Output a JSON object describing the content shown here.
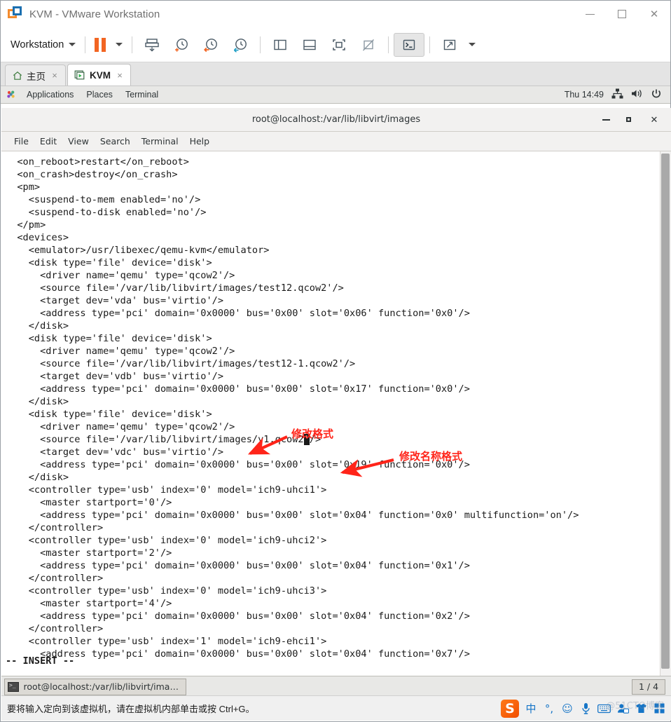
{
  "vmware": {
    "title": "KVM - VMware Workstation",
    "logo_icon": "vmware-logo-icon",
    "window_controls": {
      "minimize": "minimize-icon",
      "maximize": "maximize-icon",
      "close": "close-icon"
    },
    "toolbar": {
      "workstation_label": "Workstation",
      "items": [
        {
          "name": "pause-vm-button",
          "icon": "pause-icon"
        },
        {
          "name": "pause-dropdown-button",
          "icon": "chevron-down-icon"
        },
        {
          "name": "send-ctrl-alt-del-button",
          "icon": "send-key-icon"
        },
        {
          "name": "take-snapshot-button",
          "icon": "snapshot-add-icon"
        },
        {
          "name": "revert-snapshot-button",
          "icon": "snapshot-revert-icon"
        },
        {
          "name": "manage-snapshots-button",
          "icon": "snapshot-manage-icon"
        },
        {
          "name": "show-library-button",
          "icon": "panel-left-icon"
        },
        {
          "name": "show-thumbnail-bar-button",
          "icon": "panel-bottom-icon"
        },
        {
          "name": "show-console-view-button",
          "icon": "console-view-icon"
        },
        {
          "name": "hide-console-view-button",
          "icon": "console-view-off-icon"
        },
        {
          "name": "full-screen-button",
          "icon": "terminal-prompt-icon"
        },
        {
          "name": "unity-mode-button",
          "icon": "expand-arrows-icon"
        },
        {
          "name": "unity-dropdown-button",
          "icon": "chevron-down-icon"
        }
      ]
    },
    "tabs": [
      {
        "name": "tab-home",
        "label": "主页",
        "icon": "home-icon",
        "active": false,
        "close": "×"
      },
      {
        "name": "tab-kvm",
        "label": "KVM",
        "icon": "vm-running-icon",
        "active": true,
        "close": "×"
      }
    ],
    "statusbar": {
      "message": "要将输入定向到该虚拟机，请在虚拟机内部单击或按 Ctrl+G。"
    }
  },
  "guest_panel": {
    "menus": [
      "Applications",
      "Places",
      "Terminal"
    ],
    "clock": "Thu 14:49",
    "tray": [
      {
        "name": "network-icon",
        "glyph": "network"
      },
      {
        "name": "volume-icon",
        "glyph": "volume"
      },
      {
        "name": "power-icon",
        "glyph": "power"
      }
    ]
  },
  "terminal": {
    "title": "root@localhost:/var/lib/libvirt/images",
    "window_controls": {
      "minimize": "minimize-icon",
      "maximize": "maximize-icon",
      "close": "close-icon"
    },
    "menus": [
      "File",
      "Edit",
      "View",
      "Search",
      "Terminal",
      "Help"
    ],
    "mode_line": "-- INSERT --",
    "content_before_cursor": "  <on_reboot>restart</on_reboot>\n  <on_crash>destroy</on_crash>\n  <pm>\n    <suspend-to-mem enabled='no'/>\n    <suspend-to-disk enabled='no'/>\n  </pm>\n  <devices>\n    <emulator>/usr/libexec/qemu-kvm</emulator>\n    <disk type='file' device='disk'>\n      <driver name='qemu' type='qcow2'/>\n      <source file='/var/lib/libvirt/images/test12.qcow2'/>\n      <target dev='vda' bus='virtio'/>\n      <address type='pci' domain='0x0000' bus='0x00' slot='0x06' function='0x0'/>\n    </disk>\n    <disk type='file' device='disk'>\n      <driver name='qemu' type='qcow2'/>\n      <source file='/var/lib/libvirt/images/test12-1.qcow2'/>\n      <target dev='vdb' bus='virtio'/>\n      <address type='pci' domain='0x0000' bus='0x00' slot='0x17' function='0x0'/>\n    </disk>\n    <disk type='file' device='disk'>\n      <driver name='qemu' type='qcow2'/>\n      <source file='/var/lib/libvirt/images/y1.qcow2",
    "cursor_char": "'",
    "content_after_cursor": "/>\n      <target dev='vdc' bus='virtio'/>\n      <address type='pci' domain='0x0000' bus='0x00' slot='0x19' function='0x0'/>\n    </disk>\n    <controller type='usb' index='0' model='ich9-uhci1'>\n      <master startport='0'/>\n      <address type='pci' domain='0x0000' bus='0x00' slot='0x04' function='0x0' multifunction='on'/>\n    </controller>\n    <controller type='usb' index='0' model='ich9-uhci2'>\n      <master startport='2'/>\n      <address type='pci' domain='0x0000' bus='0x00' slot='0x04' function='0x1'/>\n    </controller>\n    <controller type='usb' index='0' model='ich9-uhci3'>\n      <master startport='4'/>\n      <address type='pci' domain='0x0000' bus='0x00' slot='0x04' function='0x2'/>\n    </controller>\n    <controller type='usb' index='1' model='ich9-ehci1'>\n      <address type='pci' domain='0x0000' bus='0x00' slot='0x04' function='0x7'/>",
    "annotations": [
      {
        "name": "annotation-modify-format",
        "text": "修改格式",
        "color": "#ff2419"
      },
      {
        "name": "annotation-modify-name-format",
        "text": "修改名称格式",
        "color": "#ff2419"
      }
    ]
  },
  "guest_taskbar": {
    "task_label": "root@localhost:/var/lib/libvirt/images",
    "task_icon": "terminal-icon",
    "workspace": "1 / 4"
  },
  "ime": {
    "logo": "S",
    "items": [
      {
        "name": "ime-chinese-mode",
        "glyph": "中"
      },
      {
        "name": "ime-punctuation-mode",
        "glyph": "°,"
      },
      {
        "name": "ime-emoji-button",
        "glyph": "☺"
      },
      {
        "name": "ime-voice-input-button",
        "glyph": "🎤"
      },
      {
        "name": "ime-soft-keyboard-button",
        "glyph": "⌨"
      },
      {
        "name": "ime-user-button",
        "glyph": "👤"
      },
      {
        "name": "ime-skin-button",
        "glyph": "👕"
      },
      {
        "name": "ime-toolbox-button",
        "glyph": "▦"
      }
    ],
    "watermark": "@51CTO博客"
  },
  "colors": {
    "accent_orange": "#f26522",
    "annotation_red": "#ff2419",
    "vm_chrome": "#ffffff",
    "guest_panel": "#e8e8e6"
  }
}
